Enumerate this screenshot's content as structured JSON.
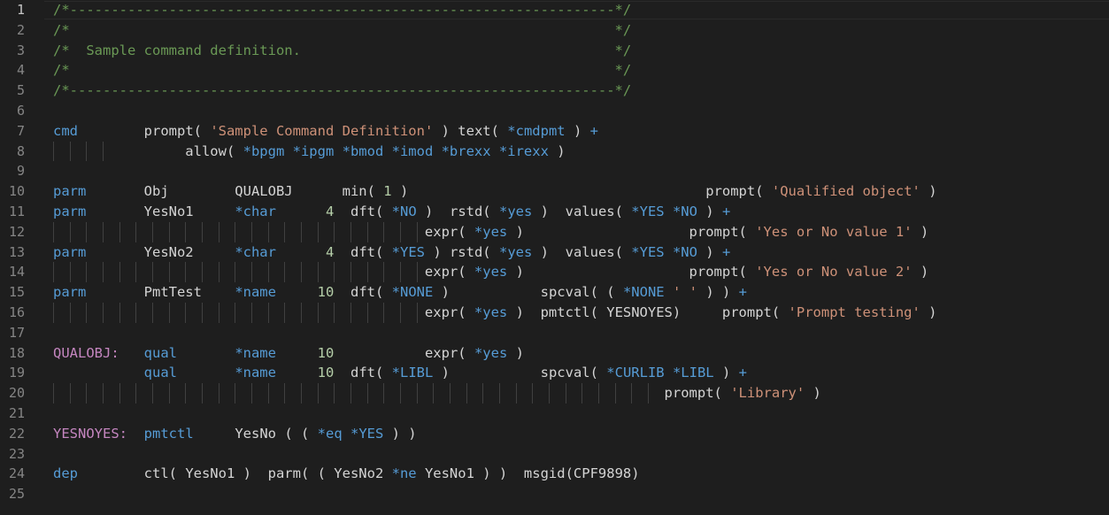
{
  "editor": {
    "line_numbers": [
      "1",
      "2",
      "3",
      "4",
      "5",
      "6",
      "7",
      "8",
      "9",
      "10",
      "11",
      "12",
      "13",
      "14",
      "15",
      "16",
      "17",
      "18",
      "19",
      "20",
      "21",
      "22",
      "23",
      "24",
      "25"
    ],
    "active_line": "1",
    "lines": [
      [
        [
          "comment",
          "/*------------------------------------------------------------------*/"
        ]
      ],
      [
        [
          "comment",
          "/*                                                                  */"
        ]
      ],
      [
        [
          "comment",
          "/*  Sample command definition.                                      */"
        ]
      ],
      [
        [
          "comment",
          "/*                                                                  */"
        ]
      ],
      [
        [
          "comment",
          "/*------------------------------------------------------------------*/"
        ]
      ],
      [],
      [
        [
          "kw",
          "cmd"
        ],
        [
          "plain",
          "        prompt( "
        ],
        [
          "str",
          "'Sample Command Definition'"
        ],
        [
          "plain",
          " ) text( "
        ],
        [
          "spec",
          "*cmdpmt"
        ],
        [
          "plain",
          " ) "
        ],
        [
          "kw",
          "+"
        ]
      ],
      [
        [
          "plain",
          "                allow( "
        ],
        [
          "spec",
          "*bpgm *ipgm *bmod *imod *brexx *irexx"
        ],
        [
          "plain",
          " )"
        ]
      ],
      [],
      [
        [
          "kw",
          "parm"
        ],
        [
          "plain",
          "       Obj        QUALOBJ      min( "
        ],
        [
          "num",
          "1"
        ],
        [
          "plain",
          " )                                    prompt( "
        ],
        [
          "str",
          "'Qualified object'"
        ],
        [
          "plain",
          " )"
        ]
      ],
      [
        [
          "kw",
          "parm"
        ],
        [
          "plain",
          "       YesNo1     "
        ],
        [
          "spec",
          "*char"
        ],
        [
          "plain",
          "      "
        ],
        [
          "num",
          "4"
        ],
        [
          "plain",
          "  dft( "
        ],
        [
          "spec",
          "*NO"
        ],
        [
          "plain",
          " )  rstd( "
        ],
        [
          "spec",
          "*yes"
        ],
        [
          "plain",
          " )  values( "
        ],
        [
          "spec",
          "*YES *NO"
        ],
        [
          "plain",
          " ) "
        ],
        [
          "kw",
          "+"
        ]
      ],
      [
        [
          "plain",
          "                                             expr( "
        ],
        [
          "spec",
          "*yes"
        ],
        [
          "plain",
          " )                    prompt( "
        ],
        [
          "str",
          "'Yes or No value 1'"
        ],
        [
          "plain",
          " )"
        ]
      ],
      [
        [
          "kw",
          "parm"
        ],
        [
          "plain",
          "       YesNo2     "
        ],
        [
          "spec",
          "*char"
        ],
        [
          "plain",
          "      "
        ],
        [
          "num",
          "4"
        ],
        [
          "plain",
          "  dft( "
        ],
        [
          "spec",
          "*YES"
        ],
        [
          "plain",
          " ) rstd( "
        ],
        [
          "spec",
          "*yes"
        ],
        [
          "plain",
          " )  values( "
        ],
        [
          "spec",
          "*YES *NO"
        ],
        [
          "plain",
          " ) "
        ],
        [
          "kw",
          "+"
        ]
      ],
      [
        [
          "plain",
          "                                             expr( "
        ],
        [
          "spec",
          "*yes"
        ],
        [
          "plain",
          " )                    prompt( "
        ],
        [
          "str",
          "'Yes or No value 2'"
        ],
        [
          "plain",
          " )"
        ]
      ],
      [
        [
          "kw",
          "parm"
        ],
        [
          "plain",
          "       PmtTest    "
        ],
        [
          "spec",
          "*name"
        ],
        [
          "plain",
          "     "
        ],
        [
          "num",
          "10"
        ],
        [
          "plain",
          "  dft( "
        ],
        [
          "spec",
          "*NONE"
        ],
        [
          "plain",
          " )           spcval( ( "
        ],
        [
          "spec",
          "*NONE"
        ],
        [
          "plain",
          " "
        ],
        [
          "str",
          "' '"
        ],
        [
          "plain",
          " ) ) "
        ],
        [
          "kw",
          "+"
        ]
      ],
      [
        [
          "plain",
          "                                             expr( "
        ],
        [
          "spec",
          "*yes"
        ],
        [
          "plain",
          " )  pmtctl( YESNOYES)     prompt( "
        ],
        [
          "str",
          "'Prompt testing'"
        ],
        [
          "plain",
          " )"
        ]
      ],
      [],
      [
        [
          "label",
          "QUALOBJ:"
        ],
        [
          "plain",
          "   "
        ],
        [
          "kw",
          "qual"
        ],
        [
          "plain",
          "       "
        ],
        [
          "spec",
          "*name"
        ],
        [
          "plain",
          "     "
        ],
        [
          "num",
          "10"
        ],
        [
          "plain",
          "           expr( "
        ],
        [
          "spec",
          "*yes"
        ],
        [
          "plain",
          " )"
        ]
      ],
      [
        [
          "plain",
          "           "
        ],
        [
          "kw",
          "qual"
        ],
        [
          "plain",
          "       "
        ],
        [
          "spec",
          "*name"
        ],
        [
          "plain",
          "     "
        ],
        [
          "num",
          "10"
        ],
        [
          "plain",
          "  dft( "
        ],
        [
          "spec",
          "*LIBL"
        ],
        [
          "plain",
          " )           spcval( "
        ],
        [
          "spec",
          "*CURLIB *LIBL"
        ],
        [
          "plain",
          " ) "
        ],
        [
          "kw",
          "+"
        ]
      ],
      [
        [
          "plain",
          "                                                                          prompt( "
        ],
        [
          "str",
          "'Library'"
        ],
        [
          "plain",
          " )"
        ]
      ],
      [],
      [
        [
          "label",
          "YESNOYES:"
        ],
        [
          "plain",
          "  "
        ],
        [
          "kw",
          "pmtctl"
        ],
        [
          "plain",
          "     YesNo ( ( "
        ],
        [
          "spec",
          "*eq *YES"
        ],
        [
          "plain",
          " ) )"
        ]
      ],
      [],
      [
        [
          "kw",
          "dep"
        ],
        [
          "plain",
          "        ctl( YesNo1 )  parm( ( YesNo2 "
        ],
        [
          "spec",
          "*ne"
        ],
        [
          "plain",
          " YesNo1 ) )  msgid(CPF9898)"
        ]
      ],
      []
    ]
  }
}
